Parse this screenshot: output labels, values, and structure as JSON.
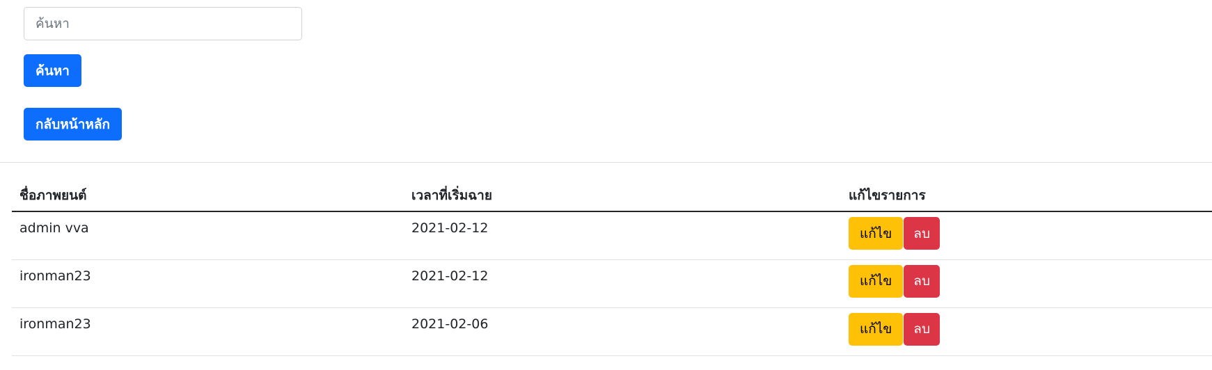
{
  "search": {
    "placeholder": "ค้นหา",
    "value": "",
    "button_label": "ค้นหา"
  },
  "nav": {
    "home_label": "กลับหน้าหลัก"
  },
  "table": {
    "headers": {
      "name": "ชื่อภาพยนต์",
      "start_time": "เวลาที่เริ่มฉาย",
      "actions": "แก้ไขรายการ"
    },
    "rows": [
      {
        "name": "admin vva",
        "start_time": "2021-02-12",
        "edit_label": "แก้ไข",
        "delete_label": "ลบ"
      },
      {
        "name": "ironman23",
        "start_time": "2021-02-12",
        "edit_label": "แก้ไข",
        "delete_label": "ลบ"
      },
      {
        "name": "ironman23",
        "start_time": "2021-02-06",
        "edit_label": "แก้ไข",
        "delete_label": "ลบ"
      }
    ]
  },
  "colors": {
    "primary": "#0d6efd",
    "warning": "#ffc107",
    "danger": "#dc3545"
  }
}
